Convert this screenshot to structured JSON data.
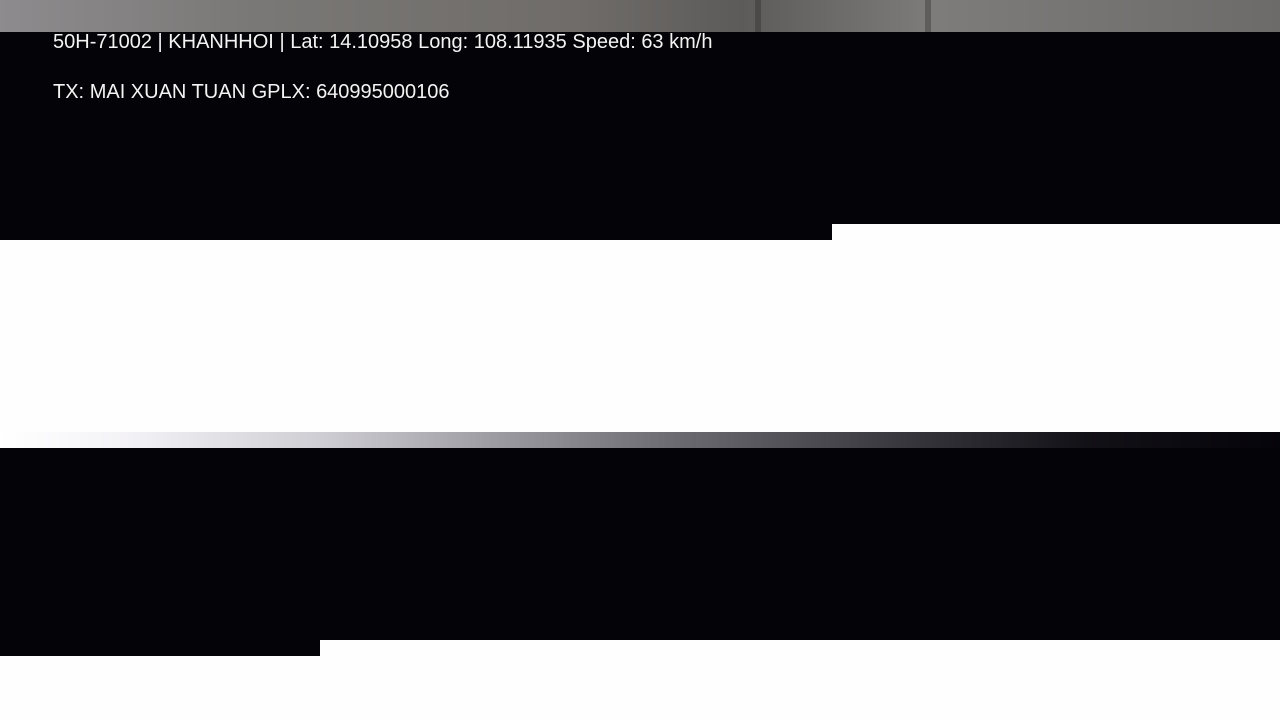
{
  "overlay": {
    "plate": "50H-71002",
    "separator": "|",
    "company": "KHANHHOI",
    "lat_label": "Lat:",
    "lat_value": "14.10958",
    "long_label": "Long:",
    "long_value": "108.11935",
    "speed_label": "Speed:",
    "speed_value": "63 km/h",
    "driver_label": "TX:",
    "driver_name": "MAI XUAN TUAN",
    "license_label": "GPLX:",
    "license_number": "640995000106"
  },
  "colors": {
    "band": "#040307",
    "background": "#fefefe",
    "text": "#f4f4f4"
  }
}
